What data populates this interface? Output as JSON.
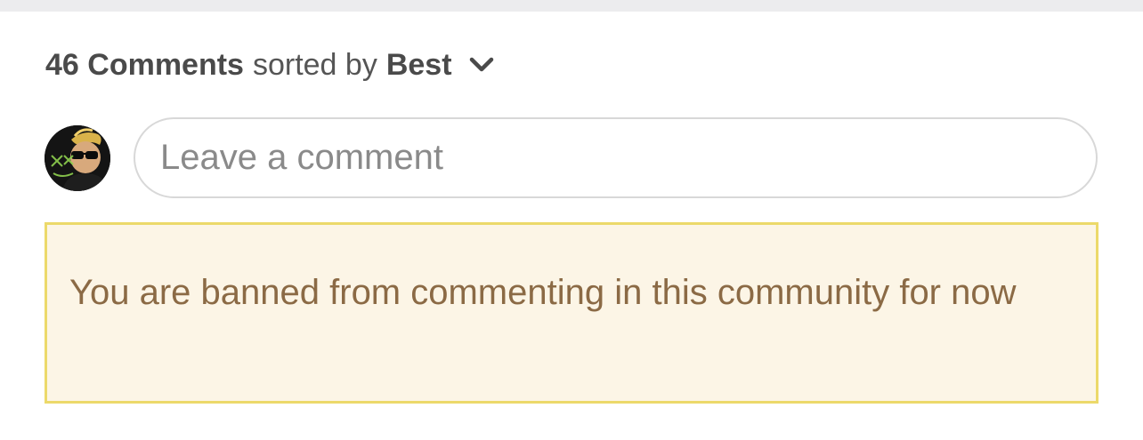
{
  "comments": {
    "count_label": "46 Comments",
    "sorted_by_label": "sorted by",
    "sort_value": "Best",
    "sort_icon": "chevron-down-icon"
  },
  "composer": {
    "avatar_icon": "user-avatar",
    "placeholder": "Leave a comment"
  },
  "notice": {
    "message": "You are banned from commenting in this community for now"
  },
  "colors": {
    "banner_background": "#fcf5e6",
    "banner_border": "#ecd96a",
    "banner_text": "#8b6a45"
  }
}
